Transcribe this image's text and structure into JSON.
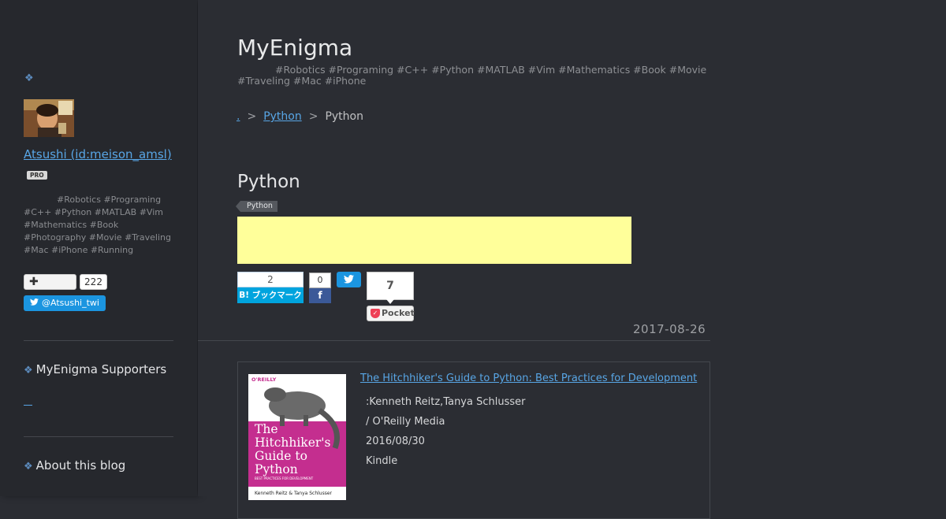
{
  "sidebar": {
    "diamond": "❖",
    "user_name": "Atsushi (id:meison_amsl)",
    "pro_badge": "PRO",
    "description": "#Robotics #Programing #C++ #Python #MATLAB #Vim #Mathematics #Book #Photography #Movie #Traveling #Mac #iPhone #Running",
    "follow_count": "222",
    "twitter_follow": "@Atsushi_twi",
    "sections": [
      {
        "icon": "❖",
        "label": "MyEnigma Supporters"
      },
      {
        "icon": "❖",
        "label": "About this blog"
      }
    ]
  },
  "header": {
    "blog_title": "MyEnigma",
    "blog_description": "#Robotics #Programing #C++ #Python #MATLAB #Vim #Mathematics #Book #Movie #Traveling #Mac #iPhone"
  },
  "breadcrumb": {
    "items": [
      ".",
      "Python",
      "Python"
    ],
    "separator": ">"
  },
  "entry": {
    "title": "Python",
    "category": "Python",
    "date": "2017-08-26"
  },
  "share": {
    "hatena_count": "2",
    "hatena_label": "B! ブックマーク",
    "facebook_count": "0",
    "facebook_icon": "f",
    "pocket_count": "7",
    "pocket_label": "Pocket"
  },
  "book": {
    "title": "The Hitchhiker's Guide to Python: Best Practices for Development",
    "author": ":Kenneth Reitz,Tanya Schlusser",
    "publisher": "/ O'Reilly Media",
    "date": "2016/08/30",
    "format": "Kindle",
    "cover_publisher": "O'REILLY",
    "cover_title": "The Hitchhiker's Guide to Python",
    "cover_subtitle": "BEST PRACTICES FOR DEVELOPMENT",
    "cover_authors": "Kenneth Reitz & Tanya Schlusser"
  },
  "colors": {
    "link": "#58a6e6",
    "background": "#2b2d33",
    "sidebar": "#26282d",
    "ad": "#ffff9a",
    "hatena": "#00a4de",
    "facebook": "#3b5998",
    "twitter": "#1b95e0",
    "pocket": "#ee4056"
  }
}
